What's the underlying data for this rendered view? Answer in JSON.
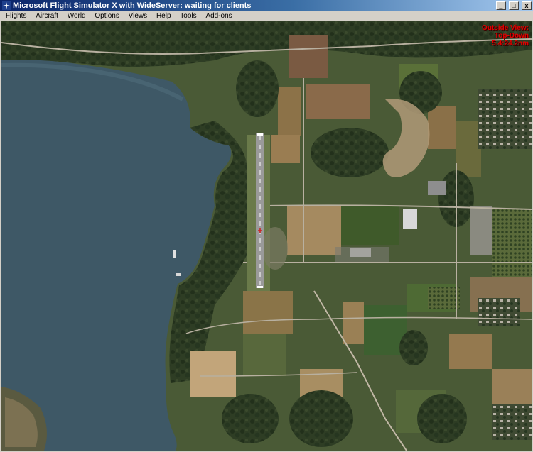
{
  "window": {
    "title": "Microsoft Flight Simulator X with WideServer: waiting for clients",
    "minimize_glyph": "_",
    "maximize_glyph": "□",
    "close_glyph": "x"
  },
  "menu": {
    "items": [
      "Flights",
      "Aircraft",
      "World",
      "Options",
      "Views",
      "Help",
      "Tools",
      "Add-ons"
    ]
  },
  "view_overlay": {
    "line1": "Outside View:",
    "line2": "Top-Down",
    "line3": "5.4:24.2nm"
  },
  "colors": {
    "water": "#3e5866",
    "land": "#4a5a36",
    "runway": "#9a9a9a",
    "overlay_text": "#e00000",
    "titlebar_start": "#0a246a",
    "titlebar_end": "#a6caf0"
  },
  "icons": {
    "app": "airplane-icon"
  }
}
